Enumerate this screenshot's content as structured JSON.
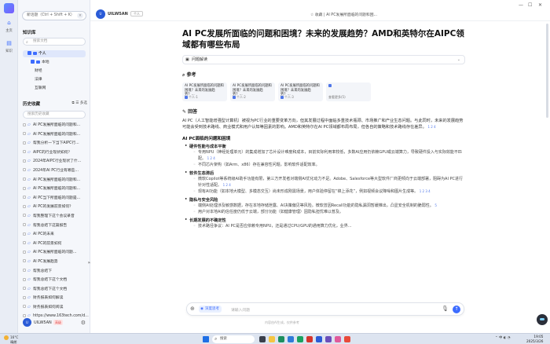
{
  "rail": {
    "items": [
      {
        "label": "主页",
        "icon": "home-icon"
      },
      {
        "label": "知识",
        "icon": "knowledge-icon"
      }
    ]
  },
  "sidebar": {
    "new_chat": "新话题（Ctrl + Shift + K）",
    "kb_title": "知识库",
    "kb_search_placeholder": "搜索文档",
    "tree": [
      {
        "label": "个人",
        "selected": true
      },
      {
        "label": "本地"
      },
      {
        "label": "财经"
      },
      {
        "label": "法律"
      },
      {
        "label": "互联网"
      }
    ],
    "history_title": "历史收藏",
    "history_tools": "多选",
    "history_search_placeholder": "搜索历史收藏",
    "history_items": [
      "AI PC发展所面临的问题和...",
      "AI PC发展所面临的问题和...",
      "帮我分析一下当下AIPC行...",
      "AIPC的行业现状如何？",
      "2024年AIPC行业现状了什...",
      "2024年AI PC行业有哪些...",
      "AI PC发展所面临的问题和...",
      "AI PC发展所面临的问题和...",
      "AI PC当下所面临的问题是...",
      "AI PC的发展前景如何？",
      "帮我整理下这个会议录音",
      "帮我总结下这篇报告",
      "AI PC的未来",
      "AI PC的前景如何",
      "AI PC发展所面临的问题...",
      "AI PC发展趋势",
      "帮我总结下",
      "帮我总结下这个文档",
      "帮我总结下这个文档",
      "财务报表如何解读",
      "财务报表如何阅读",
      "https://www.163tech.com/d..."
    ],
    "user": {
      "name": "UILW5AN",
      "badge": "高级"
    }
  },
  "topbar": {
    "user": "UILW5AN",
    "badge": "个人",
    "right_text": "☆ 收藏  |  AI PC发展所面临的问题和困..."
  },
  "content": {
    "title": "AI PC发展所面临的问题和困境？未来的发展趋势？AMD和英特尔在AIPC领域都有哪些布局",
    "dropdown": "问题解读",
    "refs_title": "参考",
    "refs": [
      {
        "text": "AI PC发展所面临的问题和困境？未来的发展趋势？...",
        "meta": "个人·1"
      },
      {
        "text": "AI PC发展所面临的问题和困境？未来的发展趋势？...",
        "meta": "个人·2"
      },
      {
        "text": "AI PC发展所面临的问题和困境？未来的发展趋势？...",
        "meta": "个人·3"
      },
      {
        "text": "",
        "meta": "查看更多(5)"
      }
    ],
    "answer_title": "回答",
    "intro": "AI PC（人工智能增强型计算机）被视为PC行业的重要变革方向，但其发展过程中面临多重技术瓶颈、市场推广和产业生态问题。与此同时，未来的发展趋势可能会受到技术路线、商业模式和用户认知等因素的影响。AMD和英特尔在AI PC领域都布局布局，但各自的策略和技术路线存在差异。",
    "intro_sup": "1 2 4",
    "section1": "AI PC面临的问题和困境",
    "sub1": "硬件性能与成本平衡",
    "sub1_items": [
      {
        "text": "专用NPU（神经处理单元）的集成增加了芯片设计难度和成本，目前实际利用率较低，多数AI应用仍依赖GPU或云端算力，导致硬件投入与实际效能不匹配。",
        "sup": "1 2 4"
      },
      {
        "text": "不同芯片架构（如Arm、x86）存在兼容性问题，影响软件适配效率。",
        "sup": ""
      }
    ],
    "sub2": "软件生态滞后",
    "sub2_items": [
      {
        "text": "微软Copilot等系统级AI助手功能有限，第三方开发者对端侧AI优化动力不足。Adobe、Salesforce等大型软件厂商更倾向于云端部署，阻碍为AI PC进行针对性适配。",
        "sup": "1 2 4"
      },
      {
        "text": "现有AI功能（如本地大模型、多模态交互）尚未形成刚需场景，用户体验停留在“锦上添花”，例如视频会议降噪和图片生成等。",
        "sup": "1 2 3 4"
      }
    ],
    "sub3": "隐私与安全风险",
    "sub3_items": [
      {
        "text": "端侧AI处理涉及敏感数据，存在本地存储泄露、AI决策偏见等风险。微软曾因Recall功能的隐私漏洞暂缓推出，凸显安全机制的脆弱性。",
        "sup": "5"
      },
      {
        "text": "用户对本地AI的信任度仍低于云端，部分功能（如健康管理）因隐私担忧难以普及。",
        "sup": ""
      }
    ],
    "sub4": "长期发展的不确定性",
    "sub4_items": [
      {
        "text": "技术路径争议：AI PC是否应依赖专用NPU，还是通过CPU/GPU的通用算力优化，业界...",
        "sup": ""
      }
    ]
  },
  "input": {
    "mode": "深度思考",
    "placeholder": "请输入问题",
    "disclaimer": "内容由AI生成，仅供参考"
  },
  "taskbar": {
    "weather_temp": "16°C",
    "weather_desc": "晴朗",
    "search": "搜索",
    "time": "19:05",
    "date": "2025/3/26"
  }
}
